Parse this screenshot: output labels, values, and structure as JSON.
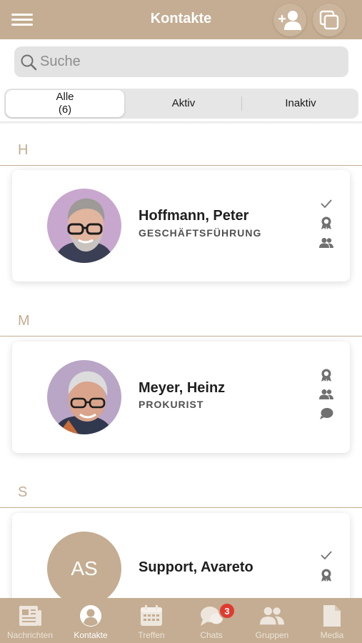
{
  "header": {
    "title": "Kontakte",
    "menu_icon": "hamburger-icon",
    "add_contact_icon": "add-user-icon",
    "copy_icon": "copy-icon"
  },
  "search": {
    "placeholder": "Suche",
    "value": ""
  },
  "filter_tabs": [
    {
      "label": "Alle",
      "count": "(6)",
      "active": true
    },
    {
      "label": "Aktiv",
      "active": false
    },
    {
      "label": "Inaktiv",
      "active": false
    }
  ],
  "sections": [
    {
      "letter": "H",
      "contacts": [
        {
          "name": "Hoffmann, Peter",
          "role": "GESCHÄFTSFÜHRUNG",
          "icons": [
            "check-icon",
            "award-icon",
            "group-icon"
          ]
        }
      ]
    },
    {
      "letter": "M",
      "contacts": [
        {
          "name": "Meyer, Heinz",
          "role": "PROKURIST",
          "icons": [
            "award-icon",
            "group-icon",
            "chat-icon"
          ]
        }
      ]
    },
    {
      "letter": "S",
      "contacts": [
        {
          "name": "Support, Avareto",
          "role": "",
          "initials": "AS",
          "icons": [
            "check-icon",
            "award-icon"
          ]
        }
      ]
    }
  ],
  "tabbar": [
    {
      "label": "Nachrichten",
      "icon": "newspaper-icon",
      "active": false
    },
    {
      "label": "Kontakte",
      "icon": "contact-icon",
      "active": true
    },
    {
      "label": "Treffen",
      "icon": "calendar-icon",
      "active": false
    },
    {
      "label": "Chats",
      "icon": "chat-icon",
      "active": false,
      "badge": "3"
    },
    {
      "label": "Gruppen",
      "icon": "group-icon",
      "active": false
    },
    {
      "label": "Media",
      "icon": "document-icon",
      "active": false
    }
  ],
  "colors": {
    "accent": "#c4ad92",
    "badge": "#e03a2f",
    "icon": "#6e6e6e"
  }
}
